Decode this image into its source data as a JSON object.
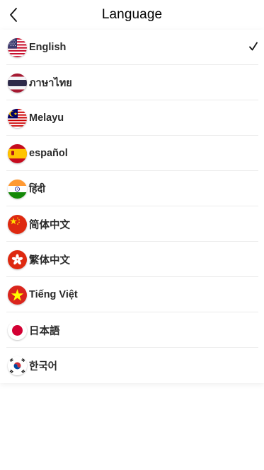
{
  "header": {
    "title": "Language"
  },
  "languages": [
    {
      "label": "English",
      "flag": "us-flag-icon",
      "selected": true
    },
    {
      "label": "ภาษาไทย",
      "flag": "thailand-flag-icon",
      "selected": false
    },
    {
      "label": "Melayu",
      "flag": "malaysia-flag-icon",
      "selected": false
    },
    {
      "label": "español",
      "flag": "spain-flag-icon",
      "selected": false
    },
    {
      "label": "हिंदी",
      "flag": "india-flag-icon",
      "selected": false
    },
    {
      "label": "简体中文",
      "flag": "china-flag-icon",
      "selected": false
    },
    {
      "label": "繁体中文",
      "flag": "hong-kong-flag-icon",
      "selected": false
    },
    {
      "label": "Tiếng Việt",
      "flag": "vietnam-flag-icon",
      "selected": false
    },
    {
      "label": "日本語",
      "flag": "japan-flag-icon",
      "selected": false
    },
    {
      "label": "한국어",
      "flag": "korea-flag-icon",
      "selected": false
    }
  ],
  "colors": {
    "text": "#2b2b2b",
    "divider": "#ebebeb",
    "check": "#111111"
  }
}
